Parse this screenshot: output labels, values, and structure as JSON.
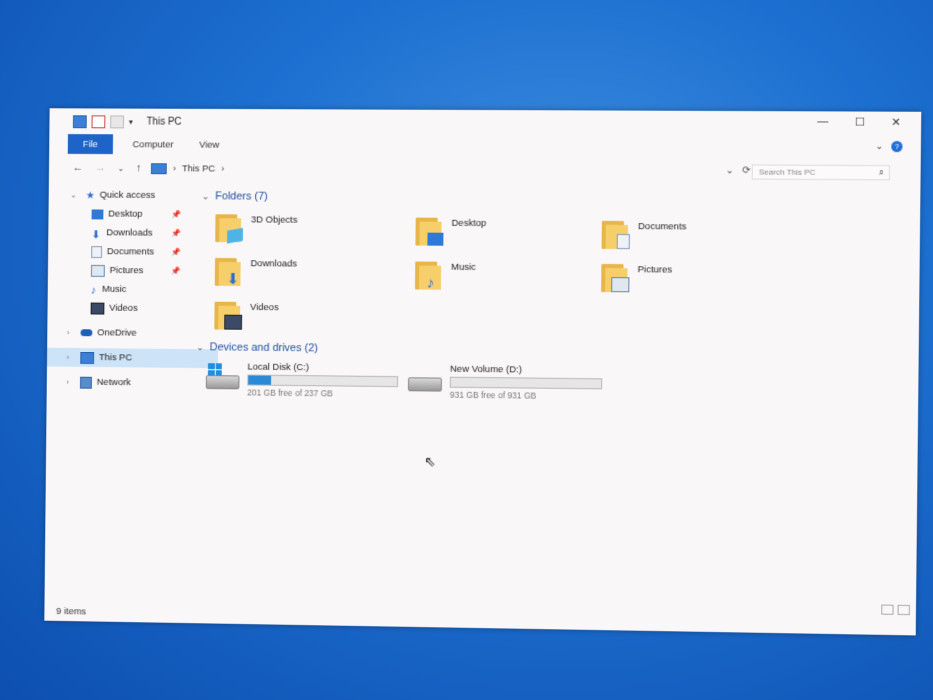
{
  "window": {
    "title": "This PC",
    "controls": {
      "minimize": "—",
      "maximize": "☐",
      "close": "✕"
    }
  },
  "ribbon": {
    "tabs": [
      "File",
      "Computer",
      "View"
    ],
    "expand": "⌄",
    "help": "?"
  },
  "address": {
    "back": "←",
    "forward": "→",
    "recent": "⌄",
    "up": "↑",
    "crumb": "This PC",
    "crumb_sep": "›",
    "dropdown": "⌄",
    "refresh": "⟳",
    "search_placeholder": "Search This PC",
    "search_icon": "⌕"
  },
  "sidebar": {
    "quick_access": "Quick access",
    "items": [
      {
        "label": "Desktop",
        "icon": "desktop-icon",
        "pinned": true
      },
      {
        "label": "Downloads",
        "icon": "downloads-icon",
        "pinned": true
      },
      {
        "label": "Documents",
        "icon": "documents-icon",
        "pinned": true
      },
      {
        "label": "Pictures",
        "icon": "pictures-icon",
        "pinned": true
      },
      {
        "label": "Music",
        "icon": "music-icon",
        "pinned": false
      },
      {
        "label": "Videos",
        "icon": "videos-icon",
        "pinned": false
      }
    ],
    "onedrive": "OneDrive",
    "this_pc": "This PC",
    "network": "Network"
  },
  "folders": {
    "header": "Folders (7)",
    "items": [
      {
        "name": "3D Objects",
        "icon": "3d-objects-folder-icon"
      },
      {
        "name": "Desktop",
        "icon": "desktop-folder-icon"
      },
      {
        "name": "Documents",
        "icon": "documents-folder-icon"
      },
      {
        "name": "Downloads",
        "icon": "downloads-folder-icon"
      },
      {
        "name": "Music",
        "icon": "music-folder-icon"
      },
      {
        "name": "Pictures",
        "icon": "pictures-folder-icon"
      },
      {
        "name": "Videos",
        "icon": "videos-folder-icon"
      }
    ]
  },
  "drives": {
    "header": "Devices and drives (2)",
    "items": [
      {
        "name": "Local Disk (C:)",
        "free": "201 GB free of 237 GB",
        "used_fraction": 0.15
      },
      {
        "name": "New Volume (D:)",
        "free": "931 GB free of 931 GB",
        "used_fraction": 0.0
      }
    ]
  },
  "status": {
    "count": "9 items"
  },
  "colors": {
    "accent": "#1e63c7",
    "selection": "#cde3f7",
    "folder": "#f6cf6b",
    "drive_bar": "#2a8ad8"
  }
}
